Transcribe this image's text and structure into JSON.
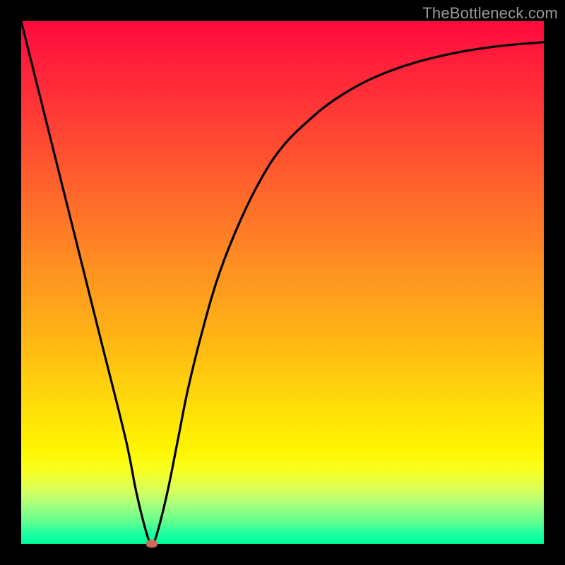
{
  "watermark": "TheBottleneck.com",
  "chart_data": {
    "type": "line",
    "title": "",
    "xlabel": "",
    "ylabel": "",
    "xlim": [
      0,
      100
    ],
    "ylim": [
      0,
      100
    ],
    "grid": false,
    "legend": false,
    "series": [
      {
        "name": "bottleneck-curve",
        "x": [
          0,
          5,
          10,
          15,
          20,
          22,
          24,
          25,
          26,
          28,
          30,
          32,
          35,
          38,
          42,
          46,
          50,
          55,
          60,
          66,
          72,
          78,
          85,
          92,
          100
        ],
        "values": [
          100,
          80,
          60,
          40,
          20,
          10,
          2,
          0,
          2,
          10,
          20,
          30,
          42,
          52,
          62,
          70,
          76,
          81,
          85,
          88.5,
          91,
          92.8,
          94.3,
          95.3,
          96
        ]
      }
    ],
    "marker": {
      "x": 25,
      "y": 0,
      "color": "#cc6b5a"
    },
    "gradient_colors": {
      "top": "#ff0a3c",
      "mid_upper": "#ff9320",
      "mid_lower": "#ffde09",
      "bottom": "#00ff9c"
    }
  }
}
